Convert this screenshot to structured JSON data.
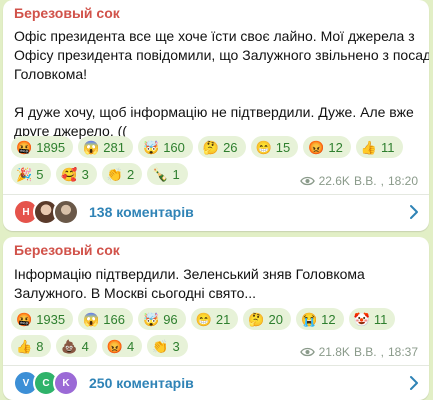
{
  "messages": [
    {
      "sender": "Березовый сок",
      "lines": [
        "Офіс президента все ще хоче їсти своє лайно. Мої джерела з",
        "Офісу президента повідомили, що Залужного звільнено з посади",
        "Головкома!",
        "",
        "Я дуже хочу, щоб інформацію не підтвердили. Дуже. Але вже",
        "друге джерело. (("
      ],
      "reactions_rows": [
        [
          {
            "emoji": "🤬",
            "count": "1895"
          },
          {
            "emoji": "😱",
            "count": "281"
          },
          {
            "emoji": "🤯",
            "count": "160"
          },
          {
            "emoji": "🤔",
            "count": "26"
          },
          {
            "emoji": "😁",
            "count": "15"
          },
          {
            "emoji": "😡",
            "count": "12"
          },
          {
            "emoji": "👍",
            "count": "11"
          }
        ],
        [
          {
            "emoji": "🎉",
            "count": "5"
          },
          {
            "emoji": "🥰",
            "count": "3"
          },
          {
            "emoji": "👏",
            "count": "2"
          },
          {
            "emoji": "🍾",
            "count": "1"
          }
        ]
      ],
      "views": "22.6K",
      "author": "В.В.",
      "time": "18:20",
      "comments_label": "138 коментарів",
      "avatars": [
        {
          "letter": "Н",
          "color": "#e5534b"
        },
        {
          "letter": "",
          "color": "#b07a5a"
        },
        {
          "letter": "",
          "color": "#7e6a5a"
        }
      ]
    },
    {
      "sender": "Березовый сок",
      "lines": [
        "Інформацію підтвердили. Зеленський зняв Головкома",
        "Залужного. В Москві сьогодні свято..."
      ],
      "reactions_rows": [
        [
          {
            "emoji": "🤬",
            "count": "1935"
          },
          {
            "emoji": "😱",
            "count": "166"
          },
          {
            "emoji": "🤯",
            "count": "96"
          },
          {
            "emoji": "😁",
            "count": "21"
          },
          {
            "emoji": "🤔",
            "count": "20"
          },
          {
            "emoji": "😭",
            "count": "12"
          },
          {
            "emoji": "🤡",
            "count": "11"
          }
        ],
        [
          {
            "emoji": "👍",
            "count": "8"
          },
          {
            "emoji": "💩",
            "count": "4"
          },
          {
            "emoji": "😡",
            "count": "4"
          },
          {
            "emoji": "👏",
            "count": "3"
          }
        ]
      ],
      "views": "21.8K",
      "author": "В.В.",
      "time": "18:37",
      "comments_label": "250 коментарів",
      "avatars": [
        {
          "letter": "V",
          "color": "#3c8fd6"
        },
        {
          "letter": "C",
          "color": "#2fb36a"
        },
        {
          "letter": "K",
          "color": "#9b6ad6"
        }
      ]
    }
  ],
  "colors": {
    "background": "#e2efc6",
    "sender": "#d1524a",
    "reaction_bg": "#e7f2d8",
    "reaction_text": "#2e7f2e",
    "link": "#2f83b6"
  },
  "icons": {
    "views": "eye-icon",
    "comments_arrow": "chevron-right-icon"
  }
}
